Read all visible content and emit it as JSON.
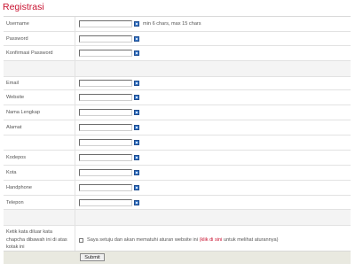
{
  "page_title": "Registrasi",
  "fields": [
    {
      "label": "Username",
      "hint": "min 6 chars, max 15 chars"
    },
    {
      "label": "Password"
    },
    {
      "label": "Konfirmasi Password"
    },
    {
      "label": "Email"
    },
    {
      "label": "Website"
    },
    {
      "label": "Nama Lengkap"
    },
    {
      "label": "Alamat"
    },
    {
      "label": ""
    },
    {
      "label": "Kodepos"
    },
    {
      "label": "Kota"
    },
    {
      "label": "Handphone"
    },
    {
      "label": "Telepon"
    }
  ],
  "agreement": {
    "label": "Ketik kata diluar kata chapcha dibawah ini di atas kotak ini",
    "text_before": "Saya setuju dan akan mematuhi aturan website ini",
    "link": "(klik di sini",
    "text_after": "untuk melihat aturannya)"
  },
  "submit_label": "Submit"
}
